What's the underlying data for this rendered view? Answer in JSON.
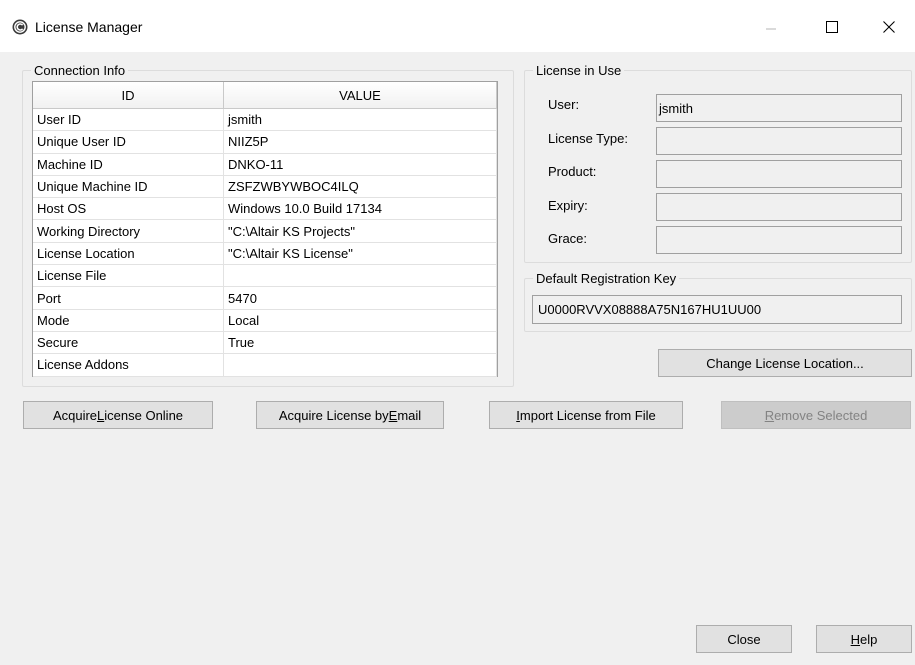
{
  "window": {
    "title": "License Manager",
    "controls": [
      "minimize",
      "maximize",
      "close"
    ]
  },
  "connection_info": {
    "legend": "Connection Info",
    "columns": [
      "ID",
      "VALUE"
    ],
    "rows": [
      {
        "id": "User ID",
        "value": "jsmith"
      },
      {
        "id": "Unique User ID",
        "value": "NIIZ5P"
      },
      {
        "id": "Machine ID",
        "value": "DNKO-11"
      },
      {
        "id": "Unique Machine ID",
        "value": "ZSFZWBYWBOC4ILQ"
      },
      {
        "id": "Host OS",
        "value": "Windows 10.0 Build 17134"
      },
      {
        "id": "Working Directory",
        "value": "\"C:\\Altair KS Projects\""
      },
      {
        "id": "License Location",
        "value": "\"C:\\Altair KS License\""
      },
      {
        "id": "License File",
        "value": ""
      },
      {
        "id": "Port",
        "value": "5470"
      },
      {
        "id": "Mode",
        "value": "Local"
      },
      {
        "id": "Secure",
        "value": "True"
      },
      {
        "id": "License Addons",
        "value": ""
      }
    ]
  },
  "license_in_use": {
    "legend": "License in Use",
    "fields": [
      {
        "label": "User:",
        "value": "jsmith"
      },
      {
        "label": "License Type:",
        "value": ""
      },
      {
        "label": "Product:",
        "value": ""
      },
      {
        "label": "Expiry:",
        "value": ""
      },
      {
        "label": "Grace:",
        "value": ""
      }
    ]
  },
  "registration": {
    "legend": "Default Registration Key",
    "key": "U0000RVVX08888A75N167HU1UU00"
  },
  "buttons": {
    "change_location": {
      "pre": "Change License Location...",
      "u": "",
      "post": ""
    },
    "acquire_online": {
      "pre": "Acquire ",
      "u": "L",
      "post": "icense Online"
    },
    "acquire_email": {
      "pre": "Acquire License by ",
      "u": "E",
      "post": "mail"
    },
    "import_file": {
      "pre": "",
      "u": "I",
      "post": "mport License from File"
    },
    "remove_selected": {
      "pre": "",
      "u": "R",
      "post": "emove Selected"
    },
    "close": {
      "pre": "Close",
      "u": "",
      "post": ""
    },
    "help": {
      "pre": "",
      "u": "H",
      "post": "elp"
    }
  }
}
